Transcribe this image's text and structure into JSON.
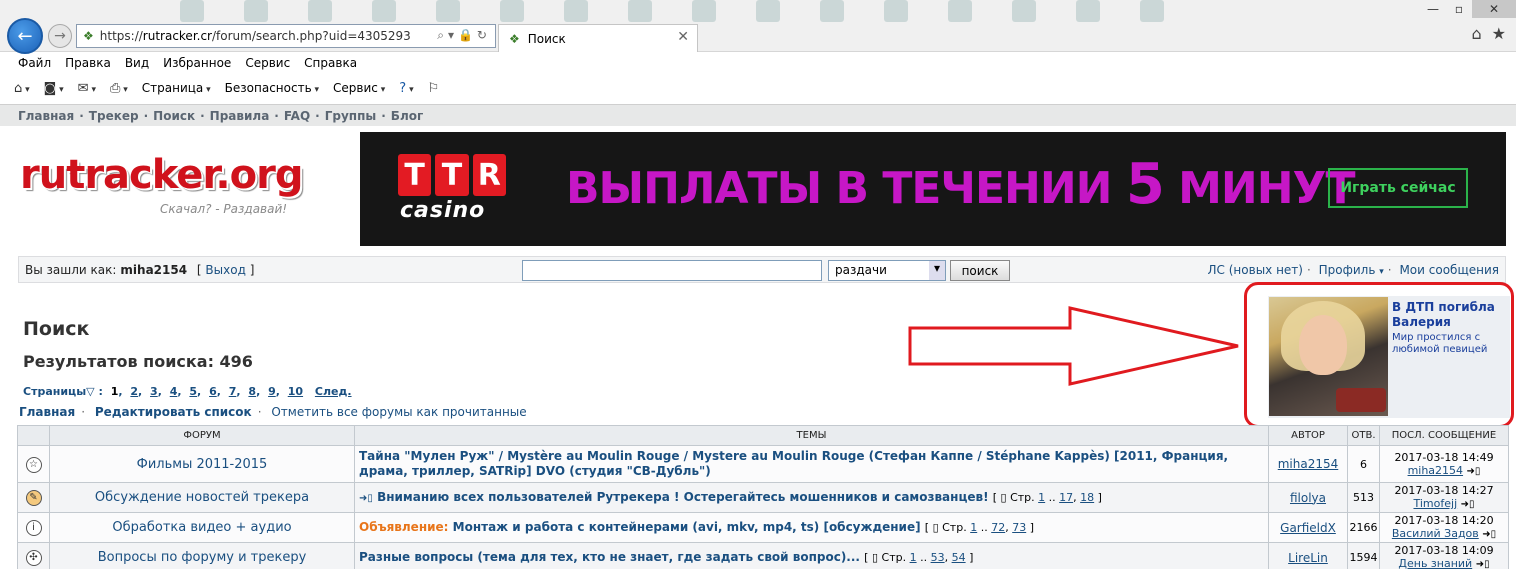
{
  "browser": {
    "url_prefix": "https://",
    "url_host": "rutracker.cr",
    "url_path": "/forum/search.php?uid=4305293",
    "tab_title": "Поиск",
    "menu": [
      "Файл",
      "Правка",
      "Вид",
      "Избранное",
      "Сервис",
      "Справка"
    ],
    "cmd": [
      "Страница",
      "Безопасность",
      "Сервис"
    ]
  },
  "sitenav": [
    "Главная",
    "Трекер",
    "Поиск",
    "Правила",
    "FAQ",
    "Группы",
    "Блог"
  ],
  "logo": {
    "word": "rutracker.org",
    "tagline": "Скачал? - Раздавай!"
  },
  "banner": {
    "brand_top": "TTR",
    "brand_bottom": "casino",
    "text": "ВЫПЛАТЫ В ТЕЧЕНИИ",
    "number": "5",
    "text_end": "МИНУТ",
    "button": "Играть сейчас"
  },
  "login": {
    "label": "Вы зашли как:",
    "user": "miha2154",
    "logout_open": "[",
    "logout": "Выход",
    "logout_close": "]",
    "search_select": "раздачи",
    "search_button": "поиск",
    "pm": "ЛС (новых нет)",
    "profile": "Профиль",
    "messages": "Мои сообщения"
  },
  "page": {
    "title": "Поиск",
    "results": "Результатов поиска: 496",
    "pages_label": "Страницы",
    "pages": [
      "1",
      "2",
      "3",
      "4",
      "5",
      "6",
      "7",
      "8",
      "9",
      "10"
    ],
    "next": "След.",
    "action_main": "Главная",
    "action_edit": "Редактировать список",
    "action_mark": "Отметить все форумы как прочитанные"
  },
  "news": {
    "title": "В ДТП погибла Валерия",
    "sub": "Мир простился с любимой певицей"
  },
  "table": {
    "headers": [
      "ФОРУМ",
      "ТЕМЫ",
      "АВТОР",
      "ОТВ.",
      "ПОСЛ. СООБЩЕНИЕ"
    ],
    "rows": [
      {
        "forum": "Фильмы 2011-2015",
        "topic": "Тайна \"Мулен Руж\" / Mystère au Moulin Rouge / Mystere au Moulin Rouge (Стефан Каппе / Stéphane Kappès) [2011, Франция, драма, триллер, SATRip] DVO (студия \"СВ-Дубль\")",
        "author": "miha2154",
        "replies": "6",
        "last_time": "2017-03-18 14:49",
        "last_user": "miha2154"
      },
      {
        "forum": "Обсуждение новостей трекера",
        "topic": "Вниманию всех пользователей Рутрекера ! Остерегайтесь мошенников и самозванцев!",
        "pages": [
          "1",
          "17",
          "18"
        ],
        "author": "filolya",
        "replies": "513",
        "last_time": "2017-03-18 14:27",
        "last_user": "Timofejj"
      },
      {
        "forum": "Обработка видео + аудио",
        "announce": "Объявление:",
        "topic": "Монтаж и работа с контейнерами (avi, mkv, mp4, ts) [обсуждение]",
        "pages": [
          "1",
          "72",
          "73"
        ],
        "author": "GarfieldX",
        "replies": "2166",
        "last_time": "2017-03-18 14:20",
        "last_user": "Василий Задов"
      },
      {
        "forum": "Вопросы по форуму и трекеру",
        "topic": "Разные вопросы (тема для тех, кто не знает, где задать свой вопрос)...",
        "pages": [
          "1",
          "53",
          "54"
        ],
        "author": "LireLin",
        "replies": "1594",
        "last_time": "2017-03-18 14:09",
        "last_user": "День знаний"
      }
    ],
    "pages_prefix": "Стр.",
    "pages_dots": ".."
  },
  "colors": {
    "accent": "#1a4f80",
    "alert": "#e01a1f",
    "banner_text": "#c617c6"
  }
}
